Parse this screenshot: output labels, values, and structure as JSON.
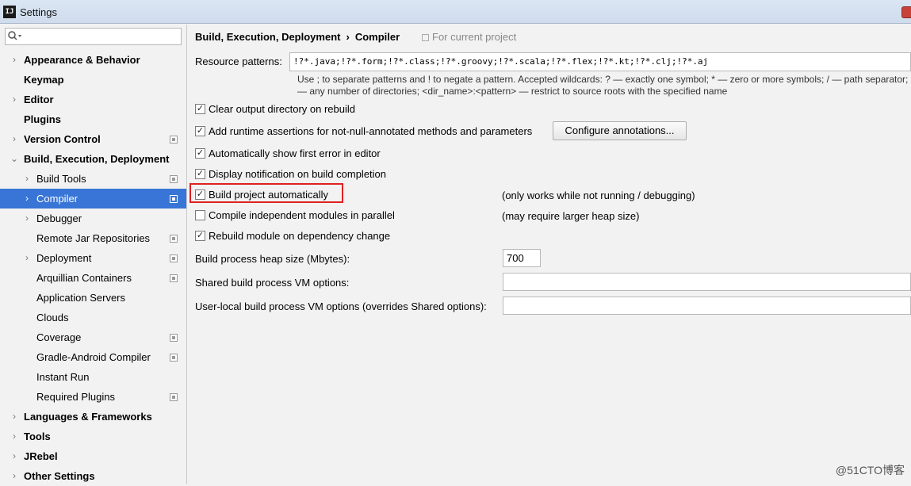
{
  "window": {
    "title": "Settings",
    "app_icon_text": "IJ"
  },
  "search": {
    "value": "",
    "placeholder": ""
  },
  "sidebar": {
    "items": [
      {
        "label": "Appearance & Behavior",
        "level": 0,
        "bold": true,
        "arrow": "›",
        "project": false,
        "selected": false
      },
      {
        "label": "Keymap",
        "level": 0,
        "bold": true,
        "arrow": "",
        "project": false,
        "selected": false
      },
      {
        "label": "Editor",
        "level": 0,
        "bold": true,
        "arrow": "›",
        "project": false,
        "selected": false
      },
      {
        "label": "Plugins",
        "level": 0,
        "bold": true,
        "arrow": "",
        "project": false,
        "selected": false
      },
      {
        "label": "Version Control",
        "level": 0,
        "bold": true,
        "arrow": "›",
        "project": true,
        "selected": false
      },
      {
        "label": "Build, Execution, Deployment",
        "level": 0,
        "bold": true,
        "arrow": "⌄",
        "project": false,
        "selected": false
      },
      {
        "label": "Build Tools",
        "level": 1,
        "bold": false,
        "arrow": "›",
        "project": true,
        "selected": false
      },
      {
        "label": "Compiler",
        "level": 1,
        "bold": false,
        "arrow": "›",
        "project": true,
        "selected": true
      },
      {
        "label": "Debugger",
        "level": 1,
        "bold": false,
        "arrow": "›",
        "project": false,
        "selected": false
      },
      {
        "label": "Remote Jar Repositories",
        "level": 1,
        "bold": false,
        "arrow": "",
        "project": true,
        "selected": false
      },
      {
        "label": "Deployment",
        "level": 1,
        "bold": false,
        "arrow": "›",
        "project": true,
        "selected": false
      },
      {
        "label": "Arquillian Containers",
        "level": 1,
        "bold": false,
        "arrow": "",
        "project": true,
        "selected": false
      },
      {
        "label": "Application Servers",
        "level": 1,
        "bold": false,
        "arrow": "",
        "project": false,
        "selected": false
      },
      {
        "label": "Clouds",
        "level": 1,
        "bold": false,
        "arrow": "",
        "project": false,
        "selected": false
      },
      {
        "label": "Coverage",
        "level": 1,
        "bold": false,
        "arrow": "",
        "project": true,
        "selected": false
      },
      {
        "label": "Gradle-Android Compiler",
        "level": 1,
        "bold": false,
        "arrow": "",
        "project": true,
        "selected": false
      },
      {
        "label": "Instant Run",
        "level": 1,
        "bold": false,
        "arrow": "",
        "project": false,
        "selected": false
      },
      {
        "label": "Required Plugins",
        "level": 1,
        "bold": false,
        "arrow": "",
        "project": true,
        "selected": false
      },
      {
        "label": "Languages & Frameworks",
        "level": 0,
        "bold": true,
        "arrow": "›",
        "project": false,
        "selected": false
      },
      {
        "label": "Tools",
        "level": 0,
        "bold": true,
        "arrow": "›",
        "project": false,
        "selected": false
      },
      {
        "label": "JRebel",
        "level": 0,
        "bold": true,
        "arrow": "›",
        "project": false,
        "selected": false
      },
      {
        "label": "Other Settings",
        "level": 0,
        "bold": true,
        "arrow": "›",
        "project": false,
        "selected": false
      }
    ]
  },
  "breadcrumb": {
    "parent": "Build, Execution, Deployment",
    "separator": "›",
    "current": "Compiler"
  },
  "scope_label": "For current project",
  "resource_patterns": {
    "label": "Resource patterns:",
    "value": "!?*.java;!?*.form;!?*.class;!?*.groovy;!?*.scala;!?*.flex;!?*.kt;!?*.clj;!?*.aj",
    "hint_line1": "Use ; to separate patterns and ! to negate a pattern. Accepted wildcards: ? — exactly one symbol; * — zero or more symbols; / — path separator; /**/",
    "hint_line2": "— any number of directories; <dir_name>:<pattern> — restrict to source roots with the specified name"
  },
  "options": {
    "clear_output": {
      "label": "Clear output directory on rebuild",
      "checked": true
    },
    "runtime_assertions": {
      "label": "Add runtime assertions for not-null-annotated methods and parameters",
      "checked": true
    },
    "configure_annotations": "Configure annotations...",
    "show_first_error": {
      "label": "Automatically show first error in editor",
      "checked": true
    },
    "display_notification": {
      "label": "Display notification on build completion",
      "checked": true
    },
    "build_automatically": {
      "label": "Build project automatically",
      "checked": true,
      "note": "(only works while not running / debugging)"
    },
    "compile_parallel": {
      "label": "Compile independent modules in parallel",
      "checked": false,
      "note": "(may require larger heap size)"
    },
    "rebuild_module": {
      "label": "Rebuild module on dependency change",
      "checked": true
    }
  },
  "heap_size": {
    "label": "Build process heap size (Mbytes):",
    "value": "700"
  },
  "shared_vm": {
    "label": "Shared build process VM options:",
    "value": ""
  },
  "user_vm": {
    "label": "User-local build process VM options (overrides Shared options):",
    "value": ""
  },
  "watermark": "@51CTO博客",
  "colors": {
    "selection": "#3875d6",
    "highlight_border": "#e02020",
    "background": "#f2f2f2"
  }
}
